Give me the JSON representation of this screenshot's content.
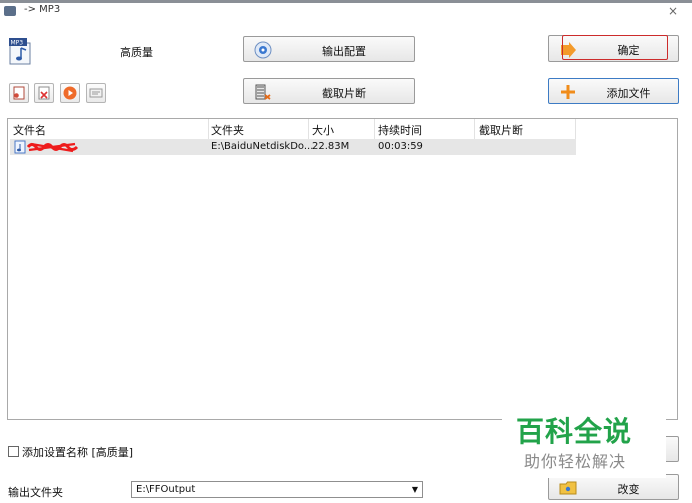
{
  "window": {
    "title": "-> MP3",
    "close_glyph": "×"
  },
  "top": {
    "quality": "高质量"
  },
  "buttons": {
    "output_config": "输出配置",
    "cut_segment": "截取片断",
    "ok": "确定",
    "add_file": "添加文件",
    "change": "改变"
  },
  "table": {
    "headers": [
      "文件名",
      "文件夹",
      "大小",
      "持续时间",
      "截取片断"
    ],
    "rows": [
      {
        "name": "",
        "folder": "E:\\BaiduNetdiskDo...",
        "size": "22.83M",
        "duration": "00:03:59",
        "segment": ""
      }
    ]
  },
  "options": {
    "add_setting_name": "添加设置名称 [高质量]"
  },
  "output": {
    "label": "输出文件夹",
    "path": "E:\\FFOutput"
  },
  "watermark": {
    "brand": "百科全说",
    "slogan": "助你轻松解决"
  },
  "colors": {
    "accent_red": "#cc2b2b",
    "orange": "#f08c1a",
    "watermark_green": "#22a34a"
  }
}
